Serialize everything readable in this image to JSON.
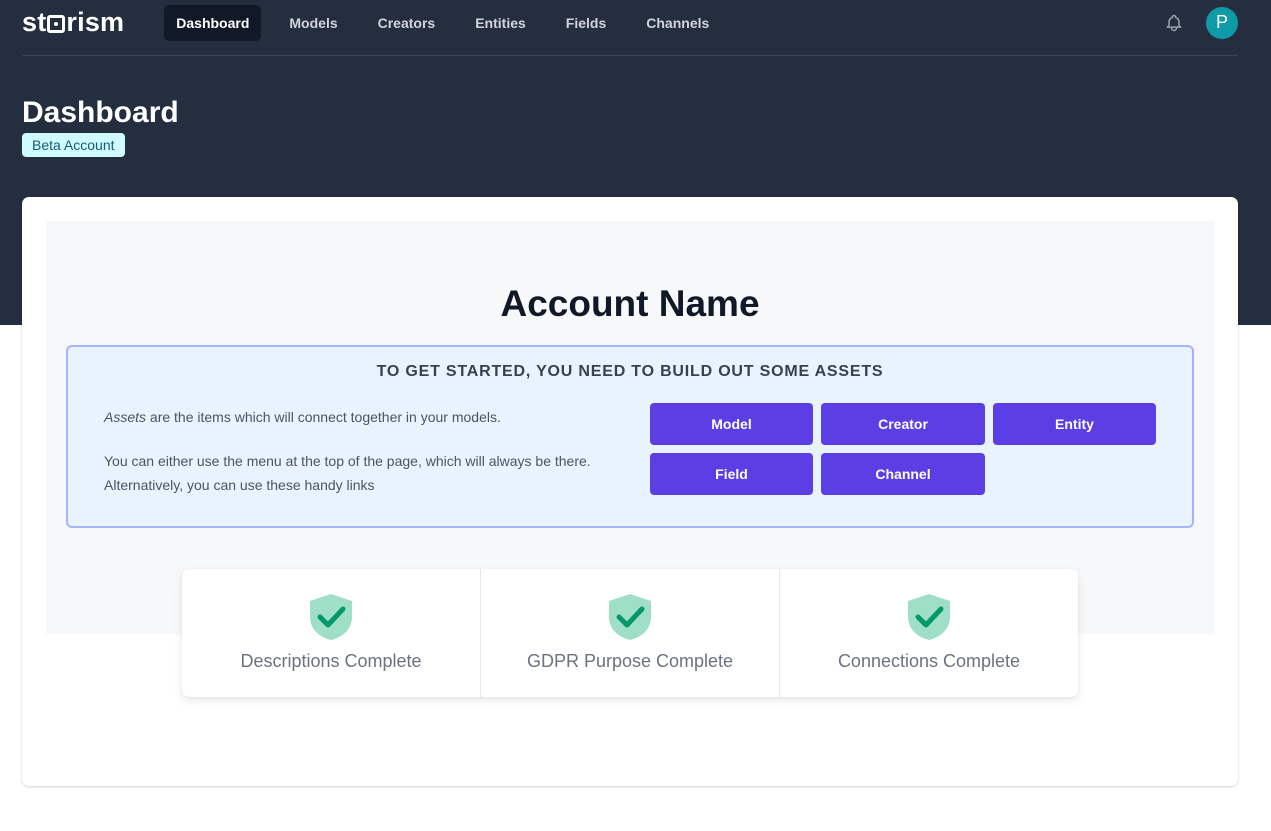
{
  "nav": {
    "logo_text": "storism",
    "items": [
      {
        "label": "Dashboard",
        "active": true
      },
      {
        "label": "Models",
        "active": false
      },
      {
        "label": "Creators",
        "active": false
      },
      {
        "label": "Entities",
        "active": false
      },
      {
        "label": "Fields",
        "active": false
      },
      {
        "label": "Channels",
        "active": false
      }
    ],
    "avatar_initial": "P",
    "icons": {
      "notifications": "bell-icon"
    }
  },
  "header": {
    "title": "Dashboard",
    "badge": "Beta Account"
  },
  "account": {
    "name": "Account Name"
  },
  "get_started": {
    "heading": "TO GET STARTED, YOU NEED TO BUILD OUT SOME ASSETS",
    "para1_emphasis": "Assets",
    "para1_rest": " are the items which will connect together in your models.",
    "para2": "You can either use the menu at the top of the page, which will always be there. Alternatively, you can use these handy links",
    "buttons": [
      "Model",
      "Creator",
      "Entity",
      "Field",
      "Channel"
    ]
  },
  "status": [
    {
      "label": "Descriptions Complete",
      "icon": "shield-check-icon"
    },
    {
      "label": "GDPR Purpose Complete",
      "icon": "shield-check-icon"
    },
    {
      "label": "Connections Complete",
      "icon": "shield-check-icon"
    }
  ],
  "colors": {
    "header_bg": "#252e3f",
    "accent_button": "#5b3fe4",
    "badge_bg": "#cffafe",
    "avatar_bg": "#0e9aa7",
    "success": "#059669"
  }
}
